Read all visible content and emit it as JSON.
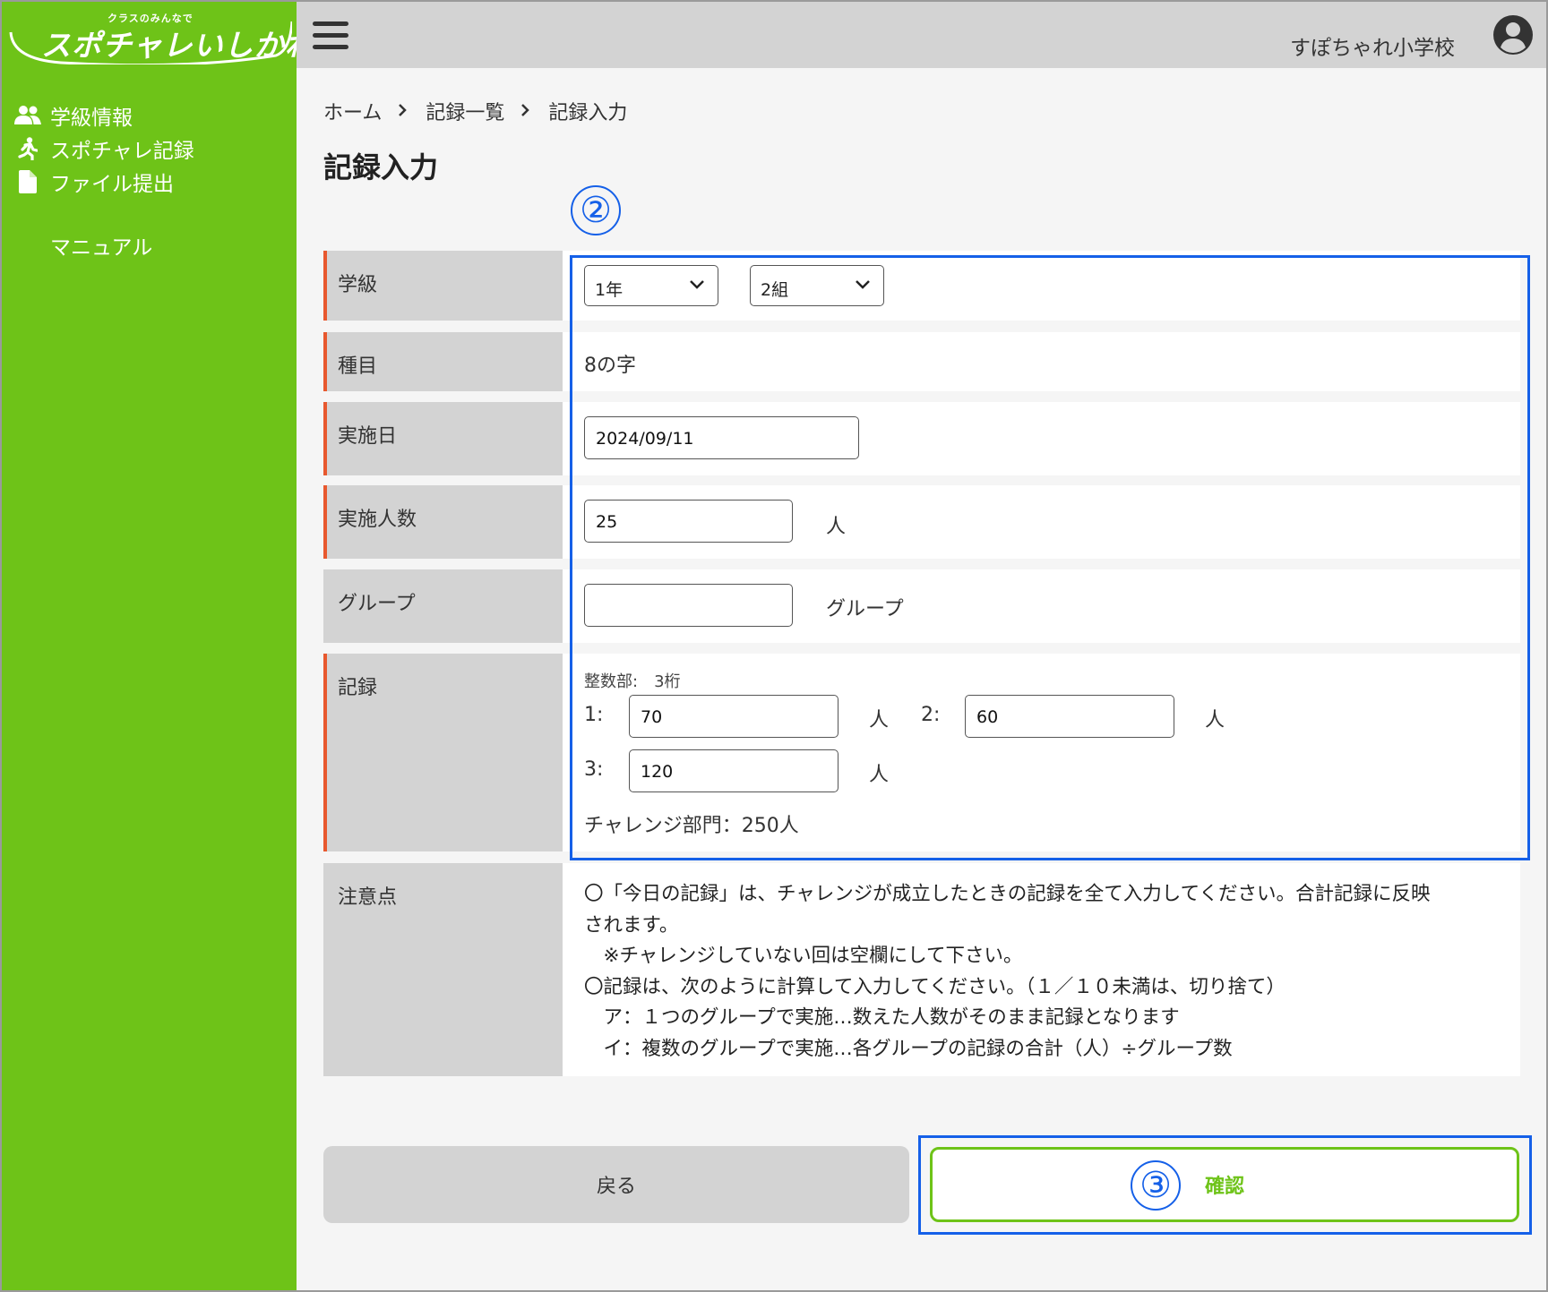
{
  "sidebar": {
    "logo_sub": "クラスのみんなで",
    "logo_main": "スポチャレいしかわ",
    "items": [
      {
        "label": "学級情報",
        "icon": "users-icon"
      },
      {
        "label": "スポチャレ記録",
        "icon": "runner-icon"
      },
      {
        "label": "ファイル提出",
        "icon": "file-icon"
      }
    ],
    "manual_label": "マニュアル"
  },
  "header": {
    "school": "すぽちゃれ小学校",
    "menu_icon": "hamburger-menu-icon",
    "user_icon": "user-account-icon"
  },
  "breadcrumb": [
    "ホーム",
    "記録一覧",
    "記録入力"
  ],
  "page_title": "記録入力",
  "form": {
    "grade": {
      "label": "学級",
      "year_value": "1年",
      "class_value": "2組"
    },
    "event": {
      "label": "種目",
      "value": "8の字"
    },
    "date": {
      "label": "実施日",
      "value": "2024/09/11"
    },
    "participants": {
      "label": "実施人数",
      "value": "25",
      "unit": "人"
    },
    "groups": {
      "label": "グループ",
      "value": "",
      "unit": "グループ"
    },
    "record": {
      "label": "記録",
      "hint": "整数部:　3桁",
      "entries": [
        {
          "index": "1:",
          "value": "70",
          "unit": "人"
        },
        {
          "index": "2:",
          "value": "60",
          "unit": "人"
        },
        {
          "index": "3:",
          "value": "120",
          "unit": "人"
        }
      ],
      "challenge": "チャレンジ部門：250人"
    },
    "notes": {
      "label": "注意点",
      "lines": [
        "〇「今日の記録」は、チャレンジが成立したときの記録を全て入力してください。合計記録に反映",
        "されます。",
        "　※チャレンジしていない回は空欄にして下さい。",
        "〇記録は、次のように計算して入力してください。（１／１０未満は、切り捨て）",
        "　ア：１つのグループで実施…数えた人数がそのまま記録となります",
        "　イ：複数のグループで実施…各グループの記録の合計（人）÷グループ数"
      ]
    }
  },
  "annotations": {
    "form_marker": "②",
    "confirm_marker": "③"
  },
  "buttons": {
    "back": "戻る",
    "confirm": "確認"
  },
  "colors": {
    "sidebar": "#6ec318",
    "header": "#d3d3d3",
    "required_marker": "#e8582e",
    "annotation": "#1560e8",
    "confirm_border": "#6ec318"
  }
}
